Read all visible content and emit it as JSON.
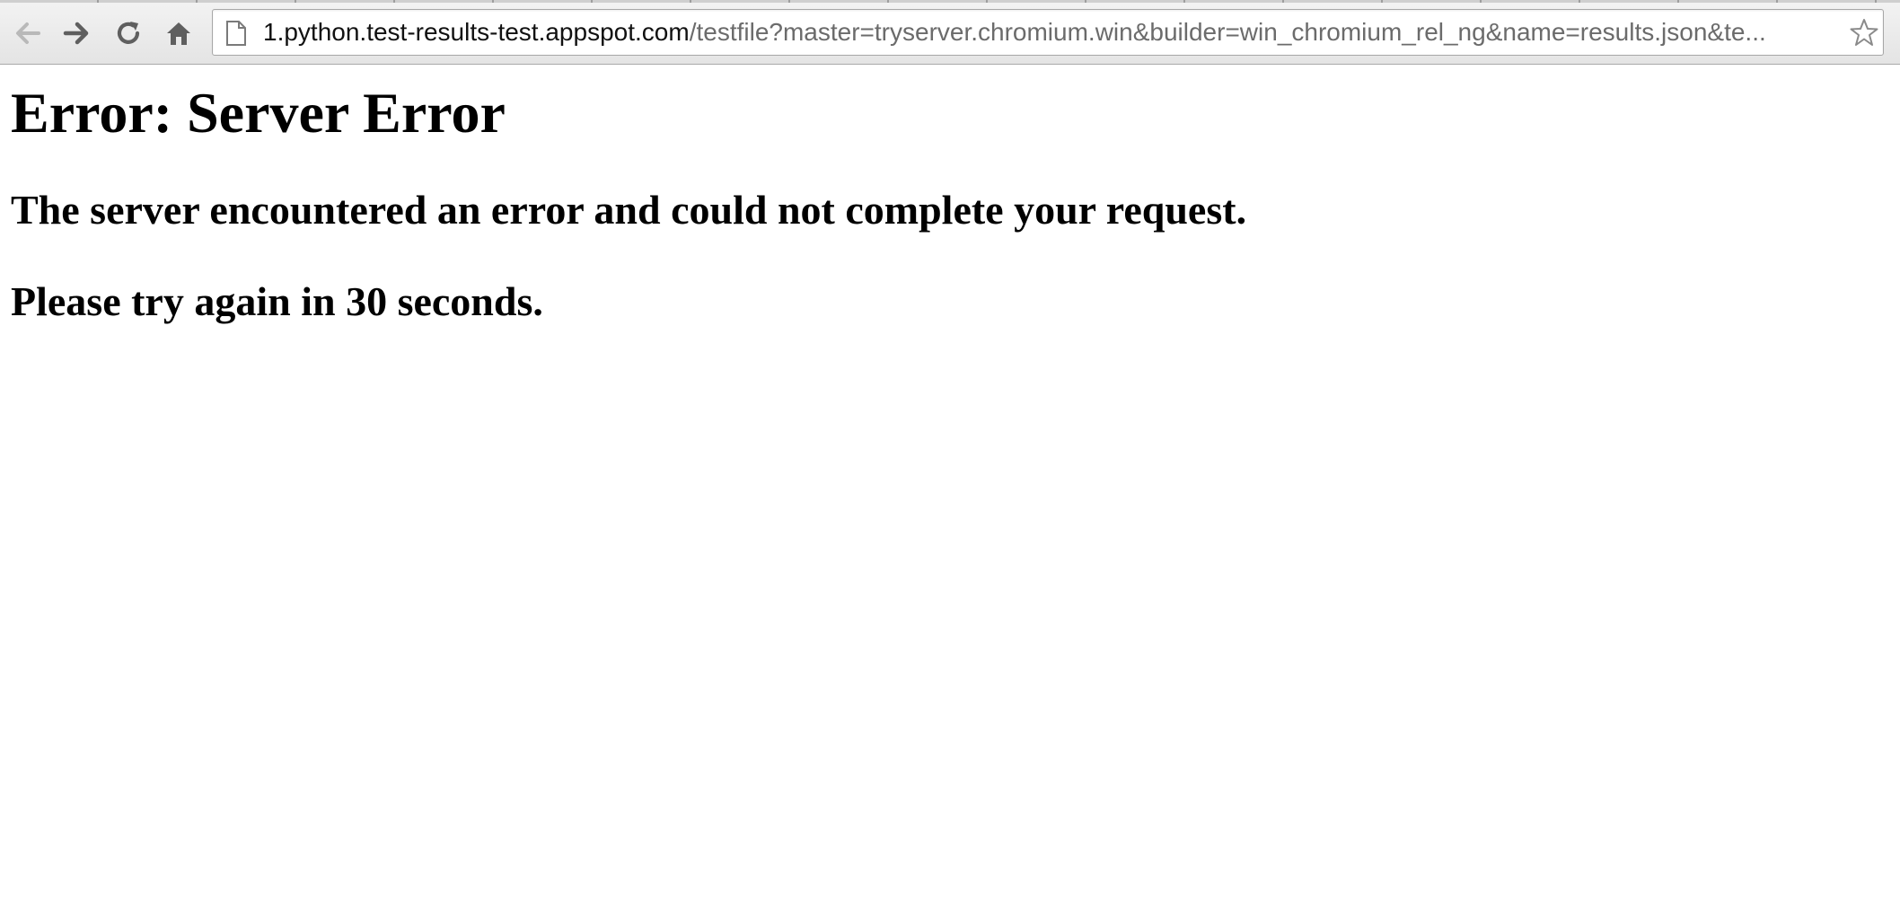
{
  "browser": {
    "url_host": "1.python.test-results-test.appspot.com",
    "url_path": "/testfile?master=tryserver.chromium.win&builder=win_chromium_rel_ng&name=results.json&te...",
    "icons": {
      "back": "back-arrow-icon",
      "forward": "forward-arrow-icon",
      "reload": "reload-icon",
      "home": "home-icon",
      "page": "page-icon",
      "bookmark": "bookmark-star-icon"
    }
  },
  "page": {
    "title": "Error: Server Error",
    "message": "The server encountered an error and could not complete your request.",
    "retry": "Please try again in 30 seconds."
  }
}
